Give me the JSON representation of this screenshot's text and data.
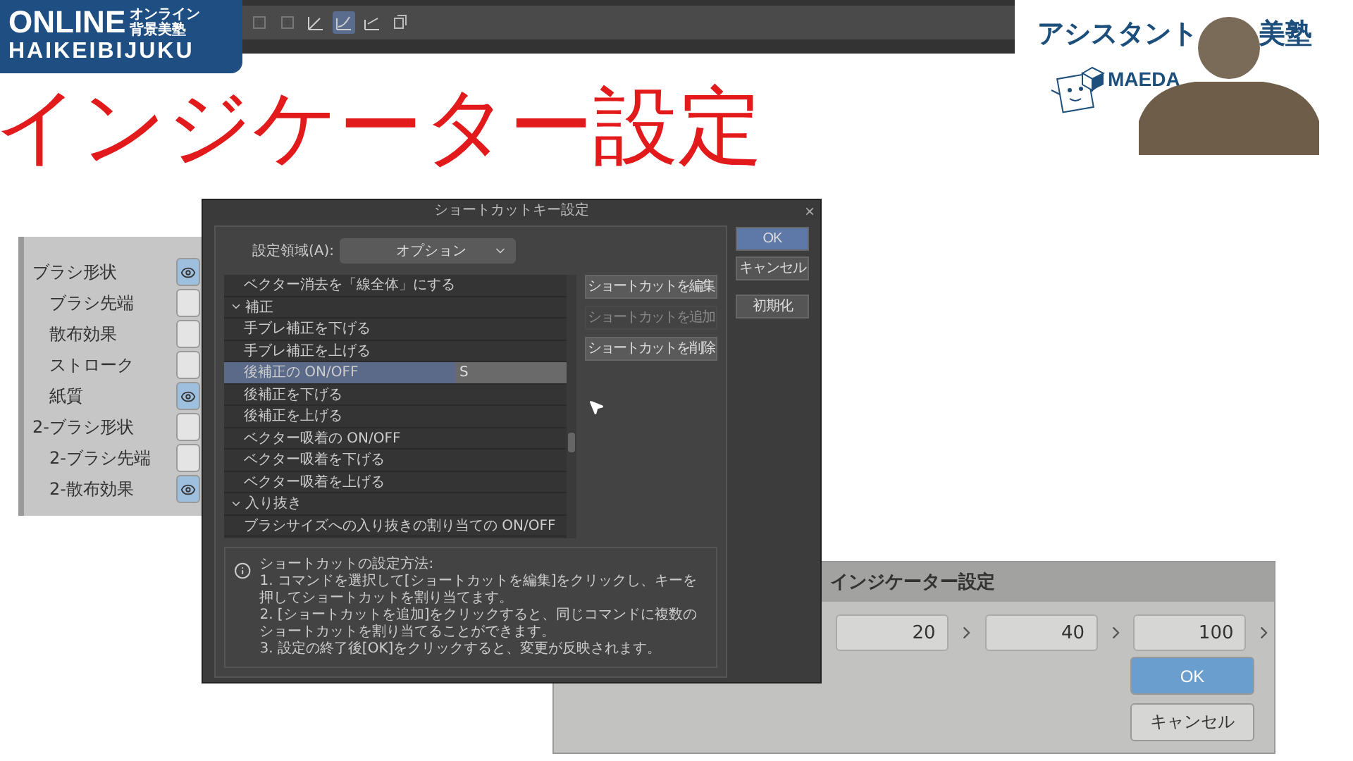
{
  "logo": {
    "line1": "ONLINE",
    "tag_top": "オンライン",
    "tag_bottom": "背景美塾",
    "line2": "HAIKEIBIJUKU"
  },
  "toolbar": {
    "tools": [
      {
        "selected": false
      },
      {
        "selected": false
      },
      {
        "selected": false
      },
      {
        "selected": true
      },
      {
        "selected": false
      },
      {
        "selected": false
      }
    ]
  },
  "title": "インジケーター設定",
  "brand": {
    "name_left": "アシスタント",
    "name_right": "美塾",
    "company": "MAEDA"
  },
  "brush_panel": {
    "items": [
      {
        "label": "ブラシ形状",
        "checked": true,
        "children": [
          {
            "label": "ブラシ先端",
            "checked": false
          },
          {
            "label": "散布効果",
            "checked": false
          },
          {
            "label": "ストローク",
            "checked": false
          },
          {
            "label": "紙質",
            "checked": true
          }
        ]
      },
      {
        "label": "2-ブラシ形状",
        "checked": false,
        "children": [
          {
            "label": "2-ブラシ先端",
            "checked": false
          },
          {
            "label": "2-散布効果",
            "checked": true
          }
        ]
      }
    ]
  },
  "shortcut_dialog": {
    "title": "ショートカットキー設定",
    "close": "×",
    "area_label": "設定領域(A):",
    "area_value": "オプション",
    "commands": [
      {
        "kind": "command",
        "label": "ベクター消去を「線全体」にする",
        "selected": false
      },
      {
        "kind": "group",
        "label": "補正",
        "expanded": true,
        "children": [
          {
            "kind": "command",
            "label": "手ブレ補正を下げる",
            "selected": false
          },
          {
            "kind": "command",
            "label": "手ブレ補正を上げる",
            "selected": false
          },
          {
            "kind": "command",
            "label": "後補正の ON/OFF",
            "selected": true,
            "shortcut": "S"
          },
          {
            "kind": "command",
            "label": "後補正を下げる",
            "selected": false
          },
          {
            "kind": "command",
            "label": "後補正を上げる",
            "selected": false
          },
          {
            "kind": "command",
            "label": "ベクター吸着の ON/OFF",
            "selected": false
          },
          {
            "kind": "command",
            "label": "ベクター吸着を下げる",
            "selected": false
          },
          {
            "kind": "command",
            "label": "ベクター吸着を上げる",
            "selected": false
          }
        ]
      },
      {
        "kind": "group",
        "label": "入り抜き",
        "expanded": true,
        "children": [
          {
            "kind": "command",
            "label": "ブラシサイズへの入り抜きの割り当ての ON/OFF",
            "selected": false
          }
        ]
      }
    ],
    "edit_buttons": [
      {
        "label": "ショートカットを編集",
        "disabled": false
      },
      {
        "label": "ショートカットを追加",
        "disabled": true
      },
      {
        "label": "ショートカットを削除",
        "disabled": false
      }
    ],
    "side_buttons": [
      {
        "label": "OK",
        "primary": true
      },
      {
        "label": "キャンセル",
        "primary": false
      },
      {
        "label": "初期化",
        "primary": false
      }
    ],
    "info": {
      "heading": "ショートカットの設定方法:",
      "lines": [
        "1. コマンドを選択して[ショートカットを編集]をクリックし、キーを押してショートカットを割り当てます。",
        "2. [ショートカットを追加]をクリックすると、同じコマンドに複数のショートカットを割り当てることができます。",
        "3. 設定の終了後[OK]をクリックすると、変更が反映されます。"
      ]
    }
  },
  "indicator_dialog": {
    "title": "インジケーター設定",
    "fields": [
      {
        "value": "20"
      },
      {
        "value": "40"
      },
      {
        "value": "100"
      }
    ],
    "buttons": [
      {
        "label": "OK",
        "primary": true
      },
      {
        "label": "キャンセル",
        "primary": false
      }
    ]
  }
}
